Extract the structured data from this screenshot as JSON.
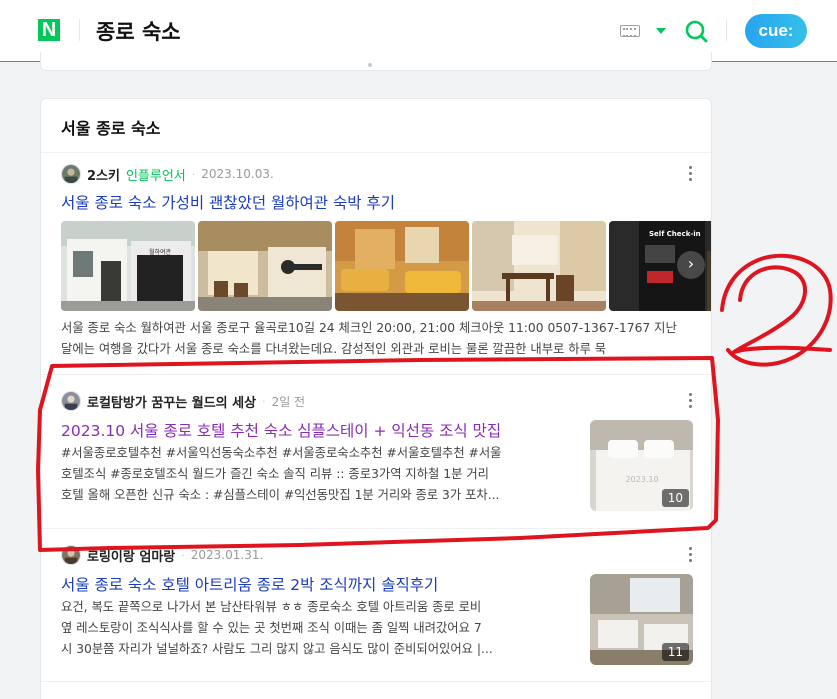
{
  "header": {
    "logo": "N",
    "query": "종로 숙소",
    "cue_label": "cue:"
  },
  "section": {
    "title": "서울 종로 숙소"
  },
  "results": [
    {
      "author": "2스키",
      "badge": "인플루언서",
      "date": "2023.10.03.",
      "title": "서울 종로 숙소 가성비 괜찮았던 월하여관 숙박 후기",
      "desc_line1": "서울 종로 숙소 월하여관 서울 종로구 율곡로10길 24 체크인 20:00, 21:00 체크아웃 11:00 0507-1367-1767 지난",
      "desc_line2": "달에는 여행을 갔다가 서울 종로 숙소를 다녀왔는데요. 감성적인 외관과 로비는 물론 깔끔한 내부로 하루 묵",
      "photo_sign_1": "월하여관",
      "photo_sign_2": "Self Check-in"
    },
    {
      "author": "로컬탐방가 꿈꾸는 월드의 세상",
      "date": "2일 전",
      "title": "2023.10 서울 종로 호텔 추천 숙소 심플스테이 + 익선동 조식 맛집",
      "desc_line1": "#서울종로호텔추천 #서울익선동숙소추천 #서울종로숙소추천 #서울호텔추천 #서울",
      "desc_line2": "호텔조식 #종로호텔조식 월드가 즐긴 숙소 솔직 리뷰 :: 종로3가역 지하철 1분 거리",
      "desc_line3": "호텔 올해 오픈한 신규 숙소 : #심플스테이 #익선동맛집 1분 거리와 종로 3가 포차...",
      "thumb_count": "10",
      "thumb_watermark": "2023.10"
    },
    {
      "author": "로링이랑 엄마랑",
      "date": "2023.01.31.",
      "title": "서울 종로 숙소 호텔 아트리움 종로 2박 조식까지 솔직후기",
      "desc_line1": "요건, 복도 끝쪽으로 나가서 본 남산타워뷰 ㅎㅎ 종로숙소 호텔 아트리움 종로 로비",
      "desc_line2": "옆 레스토랑이 조식식사를 할 수 있는 곳 첫번째 조식 이때는 좀 일찍 내려갔어요 7",
      "desc_line3": "시 30분쯤 자리가 널널하죠? 사람도 그리 많지 않고 음식도 많이 준비되어있어요 |...",
      "thumb_count": "11"
    }
  ],
  "annotation": {
    "mark": "2",
    "color": "#e0141e"
  },
  "colors": {
    "brand": "#03c75a",
    "link": "#1a3dbf",
    "visited": "#8b2ab8"
  }
}
